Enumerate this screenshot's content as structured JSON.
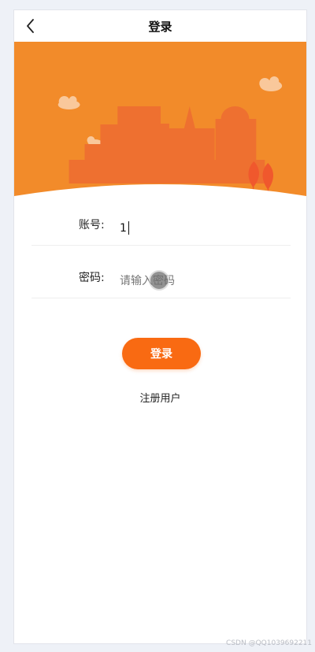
{
  "navbar": {
    "title": "登录",
    "back_icon": "chevron-left-icon"
  },
  "banner": {
    "colors": {
      "sky": "#f28b2a",
      "building": "#ee7030",
      "cloud": "#f9c89b",
      "tree": "#f0582d"
    }
  },
  "form": {
    "account": {
      "label": "账号:",
      "value": "1"
    },
    "password": {
      "label": "密码:",
      "placeholder": "请输入密码"
    }
  },
  "actions": {
    "login_label": "登录",
    "register_label": "注册用户",
    "accent_color": "#f96a12"
  },
  "watermark": "CSDN @QQ1039692211"
}
